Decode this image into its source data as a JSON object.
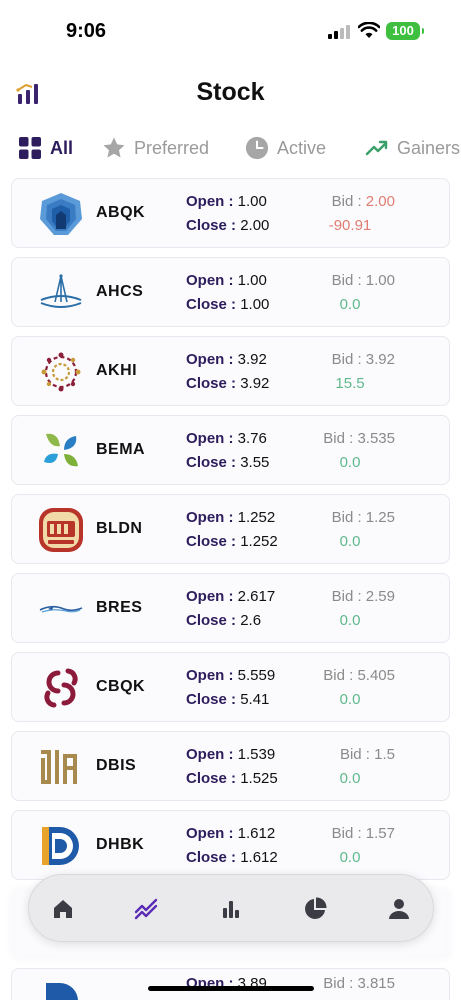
{
  "status_bar": {
    "time": "9:06",
    "battery": "100"
  },
  "header": {
    "title": "Stock"
  },
  "tabs": [
    {
      "label": "All",
      "icon": "grid-icon",
      "active": true
    },
    {
      "label": "Preferred",
      "icon": "star-icon",
      "active": false
    },
    {
      "label": "Active",
      "icon": "clock-icon",
      "active": false
    },
    {
      "label": "Gainers",
      "icon": "trending-up-icon",
      "active": false
    }
  ],
  "labels": {
    "open": "Open :",
    "close": "Close :",
    "bid": "Bid :"
  },
  "stocks": [
    {
      "symbol": "ABQK",
      "open": "1.00",
      "close": "2.00",
      "bid": "2.00",
      "change": "-90.91",
      "trend": "neg"
    },
    {
      "symbol": "AHCS",
      "open": "1.00",
      "close": "1.00",
      "bid": "1.00",
      "change": "0.0",
      "trend": "pos"
    },
    {
      "symbol": "AKHI",
      "open": "3.92",
      "close": "3.92",
      "bid": "3.92",
      "change": "15.5",
      "trend": "pos"
    },
    {
      "symbol": "BEMA",
      "open": "3.76",
      "close": "3.55",
      "bid": "3.535",
      "change": "0.0",
      "trend": "pos"
    },
    {
      "symbol": "BLDN",
      "open": "1.252",
      "close": "1.252",
      "bid": "1.25",
      "change": "0.0",
      "trend": "pos"
    },
    {
      "symbol": "BRES",
      "open": "2.617",
      "close": "2.6",
      "bid": "2.59",
      "change": "0.0",
      "trend": "pos"
    },
    {
      "symbol": "CBQK",
      "open": "5.559",
      "close": "5.41",
      "bid": "5.405",
      "change": "0.0",
      "trend": "pos"
    },
    {
      "symbol": "DBIS",
      "open": "1.539",
      "close": "1.525",
      "bid": "1.5",
      "change": "0.0",
      "trend": "pos"
    },
    {
      "symbol": "DHBK",
      "open": "1.612",
      "close": "1.612",
      "bid": "1.57",
      "change": "0.0",
      "trend": "pos"
    }
  ],
  "partial_stock": {
    "open": "3.89",
    "bid": "3.815"
  },
  "bottom_nav": [
    {
      "icon": "home-icon",
      "active": false
    },
    {
      "icon": "stock-chart-icon",
      "active": true
    },
    {
      "icon": "bar-chart-icon",
      "active": false
    },
    {
      "icon": "pie-chart-icon",
      "active": false
    },
    {
      "icon": "profile-icon",
      "active": false
    }
  ],
  "colors": {
    "accent": "#2e1d5c",
    "negative": "#e07c70",
    "positive": "#5fb88b",
    "active_nav": "#5a2bb5"
  }
}
